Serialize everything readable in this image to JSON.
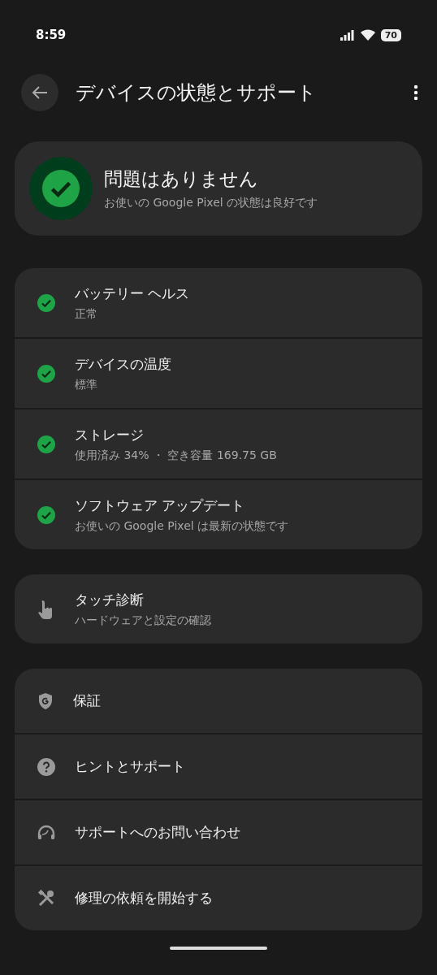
{
  "status_bar": {
    "time": "8:59",
    "battery": "70"
  },
  "header": {
    "title": "デバイスの状態とサポート"
  },
  "summary": {
    "ok": true,
    "title": "問題はありません",
    "subtitle": "お使いの Google Pixel の状態は良好です"
  },
  "checks": [
    {
      "ok": true,
      "title": "バッテリー ヘルス",
      "subtitle": "正常"
    },
    {
      "ok": true,
      "title": "デバイスの温度",
      "subtitle": "標準"
    },
    {
      "ok": true,
      "title": "ストレージ",
      "subtitle": "使用済み 34% ・ 空き容量 169.75 GB"
    },
    {
      "ok": true,
      "title": "ソフトウェア アップデート",
      "subtitle": "お使いの Google Pixel は最新の状態です"
    }
  ],
  "diagnostics": {
    "title": "タッチ診断",
    "subtitle": "ハードウェアと設定の確認"
  },
  "support": [
    {
      "title": "保証"
    },
    {
      "title": "ヒントとサポート"
    },
    {
      "title": "サポートへのお問い合わせ"
    },
    {
      "title": "修理の依頼を開始する"
    }
  ]
}
